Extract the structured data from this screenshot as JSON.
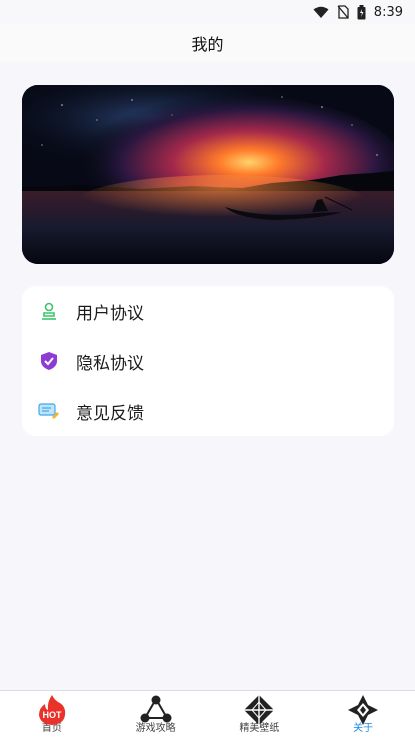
{
  "status_bar": {
    "time": "8:39",
    "icons": [
      "wifi-icon",
      "no-sim-icon",
      "battery-icon"
    ]
  },
  "header": {
    "title": "我的"
  },
  "banner": {
    "icon": "night-lake-boat-image"
  },
  "menu": {
    "items": [
      {
        "label": "用户协议",
        "icon": "user-agreement-icon",
        "color": "#3cc36b"
      },
      {
        "label": "隐私协议",
        "icon": "privacy-shield-icon",
        "color": "#8e3bd6"
      },
      {
        "label": "意见反馈",
        "icon": "feedback-chat-icon",
        "color": "#3fa9e8"
      }
    ]
  },
  "tabbar": {
    "tabs": [
      {
        "label": "首页",
        "icon": "hot-flame-icon",
        "badge": "HOT",
        "active": false
      },
      {
        "label": "游戏攻略",
        "icon": "triangle-nodes-icon",
        "active": false
      },
      {
        "label": "精美壁纸",
        "icon": "diamond-facets-icon",
        "active": false
      },
      {
        "label": "关于",
        "icon": "crossed-diamond-icon",
        "active": true
      }
    ],
    "active_color": "#1e88e5"
  }
}
